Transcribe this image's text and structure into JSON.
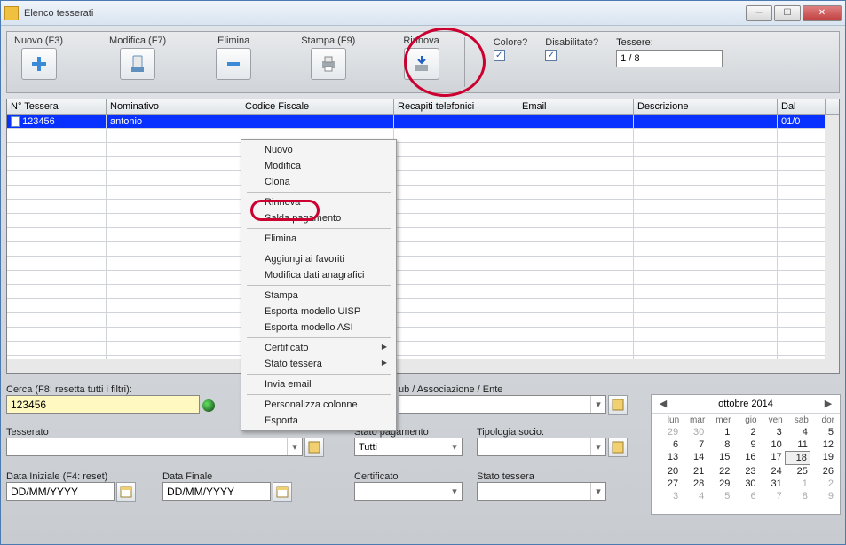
{
  "window": {
    "title": "Elenco tesserati"
  },
  "toolbar": {
    "nuovo": "Nuovo (F3)",
    "modifica": "Modifica (F7)",
    "elimina": "Elimina",
    "stampa": "Stampa (F9)",
    "rinnova": "Rinnova",
    "colore": "Colore?",
    "disabilitate": "Disabilitate?",
    "tessere_label": "Tessere:",
    "tessere_value": "1 / 8"
  },
  "grid": {
    "headers": {
      "tessera": "N° Tessera",
      "nominativo": "Nominativo",
      "cf": "Codice Fiscale",
      "recapiti": "Recapiti telefonici",
      "email": "Email",
      "descrizione": "Descrizione",
      "dal": "Dal"
    },
    "row": {
      "tessera": "123456",
      "nominativo": "antonio",
      "dal": "01/0"
    }
  },
  "context": {
    "nuovo": "Nuovo",
    "modifica": "Modifica",
    "clona": "Clona",
    "rinnova": "Rinnova",
    "salda": "Salda pagamento",
    "elimina": "Elimina",
    "favoriti": "Aggiungi ai favoriti",
    "anagrafici": "Modifica dati anagrafici",
    "stampa": "Stampa",
    "uisp": "Esporta modello UISP",
    "asi": "Esporta modello ASI",
    "certificato": "Certificato",
    "stato_tessera": "Stato tessera",
    "invia": "Invia email",
    "colonne": "Personalizza colonne",
    "esporta": "Esporta"
  },
  "filters": {
    "cerca_label": "Cerca (F8: resetta tutti i filtri):",
    "cerca_value": "123456",
    "club_label": "ub / Associazione / Ente",
    "tesserato": "Tesserato",
    "stato_pag_label": "Stato pagamento",
    "stato_pag_value": "Tutti",
    "tipologia": "Tipologia socio:",
    "data_iniziale": "Data Iniziale (F4: reset)",
    "data_finale": "Data Finale",
    "date_placeholder": "DD/MM/YYYY",
    "certificato": "Certificato",
    "stato_tessera": "Stato tessera"
  },
  "calendar": {
    "title": "ottobre 2014",
    "dow": [
      "lun",
      "mar",
      "mer",
      "gio",
      "ven",
      "sab",
      "dor"
    ],
    "weeks": [
      [
        {
          "d": "29",
          "o": true
        },
        {
          "d": "30",
          "o": true
        },
        {
          "d": "1"
        },
        {
          "d": "2"
        },
        {
          "d": "3"
        },
        {
          "d": "4"
        },
        {
          "d": "5"
        }
      ],
      [
        {
          "d": "6"
        },
        {
          "d": "7"
        },
        {
          "d": "8"
        },
        {
          "d": "9"
        },
        {
          "d": "10"
        },
        {
          "d": "11"
        },
        {
          "d": "12"
        }
      ],
      [
        {
          "d": "13"
        },
        {
          "d": "14"
        },
        {
          "d": "15"
        },
        {
          "d": "16"
        },
        {
          "d": "17"
        },
        {
          "d": "18",
          "t": true
        },
        {
          "d": "19"
        }
      ],
      [
        {
          "d": "20"
        },
        {
          "d": "21"
        },
        {
          "d": "22"
        },
        {
          "d": "23"
        },
        {
          "d": "24"
        },
        {
          "d": "25"
        },
        {
          "d": "26"
        }
      ],
      [
        {
          "d": "27"
        },
        {
          "d": "28"
        },
        {
          "d": "29"
        },
        {
          "d": "30"
        },
        {
          "d": "31"
        },
        {
          "d": "1",
          "o": true
        },
        {
          "d": "2",
          "o": true
        }
      ],
      [
        {
          "d": "3",
          "o": true
        },
        {
          "d": "4",
          "o": true
        },
        {
          "d": "5",
          "o": true
        },
        {
          "d": "6",
          "o": true
        },
        {
          "d": "7",
          "o": true
        },
        {
          "d": "8",
          "o": true
        },
        {
          "d": "9",
          "o": true
        }
      ]
    ]
  }
}
